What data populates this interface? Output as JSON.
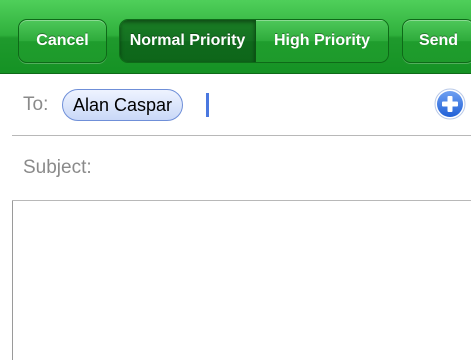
{
  "toolbar": {
    "cancel_label": "Cancel",
    "priority_options": [
      "Normal Priority",
      "High Priority"
    ],
    "selected_priority": "Normal Priority",
    "send_label": "Send",
    "accent_color": "#2fb03c"
  },
  "compose": {
    "to_label": "To:",
    "recipients": [
      "Alan Caspar"
    ],
    "add_recipient_icon": "plus-circle-icon",
    "subject_label": "Subject:",
    "subject_value": "",
    "body_value": ""
  }
}
